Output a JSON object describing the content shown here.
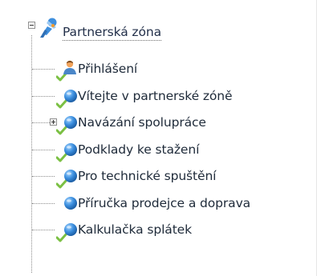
{
  "tree": {
    "root": {
      "label": "Partnerská zóna",
      "icon": "satellite-dish-icon",
      "expanded": true
    },
    "items": [
      {
        "label": "Přihlášení",
        "icon": "user-icon",
        "has_check": true,
        "expander": null
      },
      {
        "label": "Vítejte v partnerské zóně",
        "icon": "globe-icon",
        "has_check": true,
        "expander": null
      },
      {
        "label": "Navázání spolupráce",
        "icon": "globe-icon",
        "has_check": true,
        "expander": "collapsed"
      },
      {
        "label": "Podklady ke stažení",
        "icon": "globe-icon",
        "has_check": true,
        "expander": null
      },
      {
        "label": "Pro technické spuštění",
        "icon": "globe-icon",
        "has_check": true,
        "expander": null
      },
      {
        "label": "Příručka prodejce a doprava",
        "icon": "globe-icon",
        "has_check": false,
        "expander": null
      },
      {
        "label": "Kalkulačka splátek",
        "icon": "globe-icon",
        "has_check": true,
        "expander": null
      }
    ]
  },
  "colors": {
    "check_green": "#7bc043",
    "globe_blue": "#3b8ede",
    "text": "#1e2a39"
  }
}
